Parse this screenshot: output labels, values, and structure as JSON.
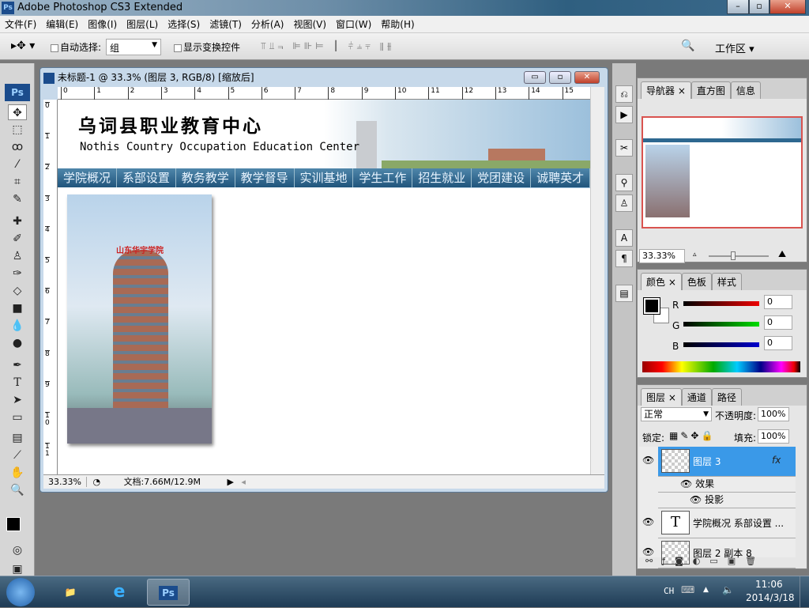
{
  "app": {
    "title": "Adobe Photoshop CS3 Extended",
    "logo": "Ps"
  },
  "menu": [
    "文件(F)",
    "编辑(E)",
    "图像(I)",
    "图层(L)",
    "选择(S)",
    "滤镜(T)",
    "分析(A)",
    "视图(V)",
    "窗口(W)",
    "帮助(H)"
  ],
  "options": {
    "auto_select_label": "自动选择:",
    "auto_select_value": "组",
    "show_transform_label": "显示变换控件",
    "workspace_label": "工作区"
  },
  "document": {
    "title": "未标题-1 @ 33.3% (图层 3, RGB/8) [缩放后]",
    "hruler": [
      "0",
      "1",
      "2",
      "3",
      "4",
      "5",
      "6",
      "7",
      "8",
      "9",
      "10",
      "11",
      "12",
      "13",
      "14",
      "15"
    ],
    "vruler": [
      "0",
      "1",
      "2",
      "3",
      "4",
      "5",
      "6",
      "7",
      "8",
      "9",
      "1\n0",
      "1\n1"
    ],
    "banner_cn": "乌词县职业教育中心",
    "banner_en": "Nothis Country Occupation Education Center",
    "photo_sign": "山东华宇学院",
    "nav": [
      "学院概况",
      "系部设置",
      "教务教学",
      "教学督导",
      "实训基地",
      "学生工作",
      "招生就业",
      "党团建设",
      "诚聘英才"
    ],
    "zoom": "33.33%",
    "doc_size": "文档:7.66M/12.9M"
  },
  "navigator": {
    "tabs": [
      "导航器",
      "直方图",
      "信息"
    ],
    "zoom": "33.33%",
    "view_box_color": "#d9534f"
  },
  "color": {
    "tabs": [
      "颜色",
      "色板",
      "样式"
    ],
    "r_label": "R",
    "g_label": "G",
    "b_label": "B",
    "r": "0",
    "g": "0",
    "b": "0",
    "foreground": "#000000",
    "background": "#ffffff"
  },
  "layers": {
    "tabs": [
      "图层",
      "通道",
      "路径"
    ],
    "blend": "正常",
    "opacity_label": "不透明度:",
    "opacity": "100%",
    "lock_label": "锁定:",
    "fill_label": "填充:",
    "fill": "100%",
    "items": [
      {
        "name": "图层 3",
        "fx": "fx",
        "selected": true
      },
      {
        "name": "效果"
      },
      {
        "name": "投影"
      },
      {
        "name": "学院概况 系部设置 ...",
        "thumb": "T"
      },
      {
        "name": "图层 2 副本 8"
      }
    ]
  },
  "taskbar": {
    "lang": "CH",
    "time": "11:06",
    "date": "2014/3/18",
    "ps_label": "Ps"
  }
}
